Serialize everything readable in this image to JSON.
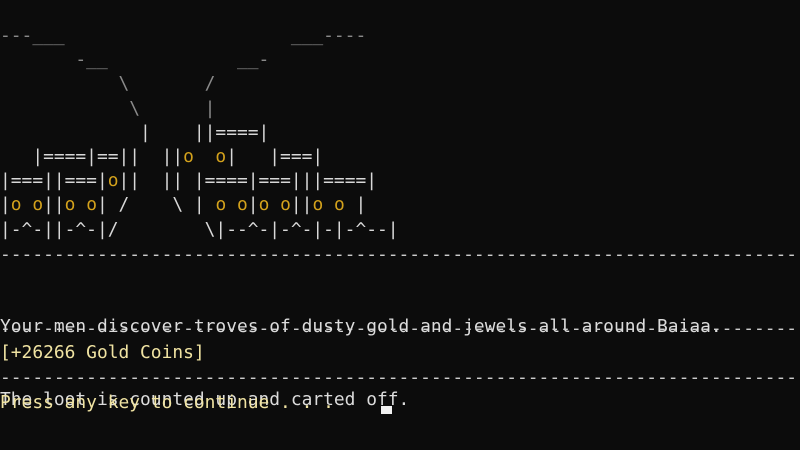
{
  "art": {
    "lines": [
      [
        {
          "t": "---___                     ___----",
          "c": "gray"
        }
      ],
      [
        {
          "t": "       -__            __-",
          "c": "gray"
        }
      ],
      [
        {
          "t": "           \\       /",
          "c": "gray"
        }
      ],
      [
        {
          "t": "            \\      |",
          "c": "gray"
        }
      ],
      [
        {
          "t": "             |    ||====|",
          "c": "white"
        }
      ],
      [
        {
          "t": "   |====|==||  ||",
          "c": "white"
        },
        {
          "t": "o  o",
          "c": "gold"
        },
        {
          "t": "|   |===|",
          "c": "white"
        }
      ],
      [
        {
          "t": "|===||===|",
          "c": "white"
        },
        {
          "t": "o",
          "c": "gold"
        },
        {
          "t": "||  || |====|===|||====|",
          "c": "white"
        }
      ],
      [
        {
          "t": "|",
          "c": "white"
        },
        {
          "t": "o o",
          "c": "gold"
        },
        {
          "t": "||",
          "c": "white"
        },
        {
          "t": "o o",
          "c": "gold"
        },
        {
          "t": "| /    \\ | ",
          "c": "white"
        },
        {
          "t": "o o",
          "c": "gold"
        },
        {
          "t": "|",
          "c": "white"
        },
        {
          "t": "o o",
          "c": "gold"
        },
        {
          "t": "||",
          "c": "white"
        },
        {
          "t": "o o",
          "c": "gold"
        },
        {
          "t": " |",
          "c": "white"
        }
      ],
      [
        {
          "t": "|-^-||-^-|/        \\|--^-|-^-|-|-^--|",
          "c": "white"
        }
      ]
    ]
  },
  "rule": "--------------------------------------------------------------------------------",
  "story": {
    "line1": "Your men discover troves of dusty gold and jewels all around Baiaa.",
    "line2": "The loot is counted up and carted off."
  },
  "reward": "[+26266 Gold Coins]",
  "prompt": "Press any key to continue . . . "
}
